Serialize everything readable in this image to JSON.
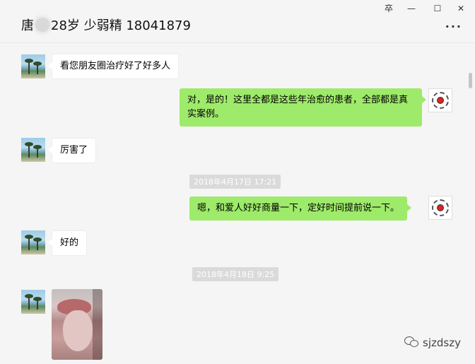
{
  "header": {
    "title_prefix": "唐",
    "title_suffix": "28岁 少弱精 18041879",
    "pin_glyph": "卒",
    "minimize_glyph": "—",
    "maximize_glyph": "☐",
    "close_glyph": "✕",
    "more_glyph": "···"
  },
  "messages": {
    "m1": "看您朋友圈治疗好了好多人",
    "m2": "对，是的！这里全都是这些年治愈的患者，全部都是真实案例。",
    "m3": "厉害了",
    "ts1": "2018年4月17日 17:21",
    "m4": "嗯，和爱人好好商量一下，定好时间提前说一下。",
    "m5": "好的",
    "ts2": "2018年4月18日 9:25"
  },
  "watermark": {
    "text": "sjzdszy"
  },
  "icons": [
    "pin-icon",
    "minimize-icon",
    "maximize-icon",
    "close-icon",
    "more-icon",
    "wechat-icon"
  ]
}
